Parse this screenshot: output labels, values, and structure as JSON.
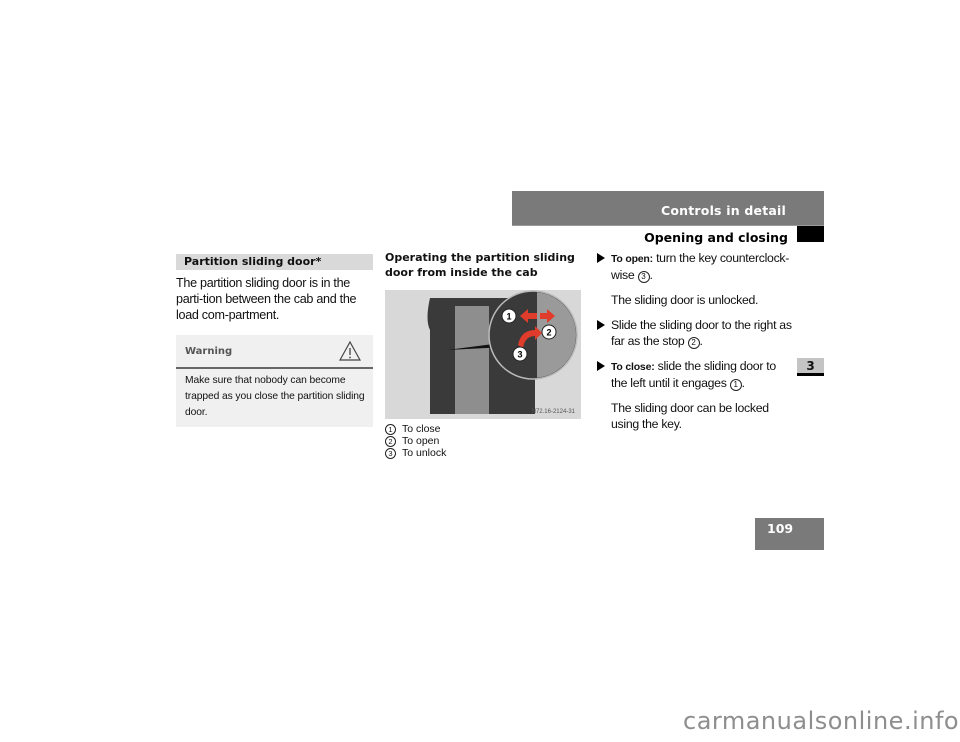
{
  "header": {
    "chapter_title": "Controls in detail",
    "section_title": "Opening and closing",
    "chapter_number": "3",
    "page_number": "109"
  },
  "left_column": {
    "subheading": "Partition sliding door*",
    "intro": "The partition sliding door is in the parti-tion between the cab and the load com-partment.",
    "warning": {
      "label": "Warning",
      "icon": "warning-triangle-icon",
      "text": "Make sure that nobody can become trapped as you close the partition sliding door."
    }
  },
  "middle_column": {
    "heading": "Operating the partition sliding door from inside the cab",
    "figure": {
      "id": "N72.16-2124-31",
      "callouts": [
        "1",
        "2",
        "3"
      ],
      "colors": {
        "arrow": "#e03c2c",
        "door_dark": "#3a3a3a",
        "panel_light": "#9a9a9a",
        "background": "#d8d8d8"
      }
    },
    "legend": [
      {
        "num": "1",
        "label": "To close"
      },
      {
        "num": "2",
        "label": "To open"
      },
      {
        "num": "3",
        "label": "To unlock"
      }
    ]
  },
  "right_column": {
    "steps": [
      {
        "type": "step",
        "lead": "To open:",
        "text": " turn the key counterclock-wise ",
        "ref": "3",
        "tail": "."
      },
      {
        "type": "para",
        "text": "The sliding door is unlocked."
      },
      {
        "type": "step",
        "lead": "",
        "text": "Slide the sliding door to the right as far as the stop ",
        "ref": "2",
        "tail": "."
      },
      {
        "type": "step",
        "lead": "To close:",
        "text": " slide the sliding door to the left until it engages ",
        "ref": "1",
        "tail": "."
      },
      {
        "type": "para",
        "text": "The sliding door can be locked using the key."
      }
    ]
  },
  "watermark": "carmanualsonline.info"
}
